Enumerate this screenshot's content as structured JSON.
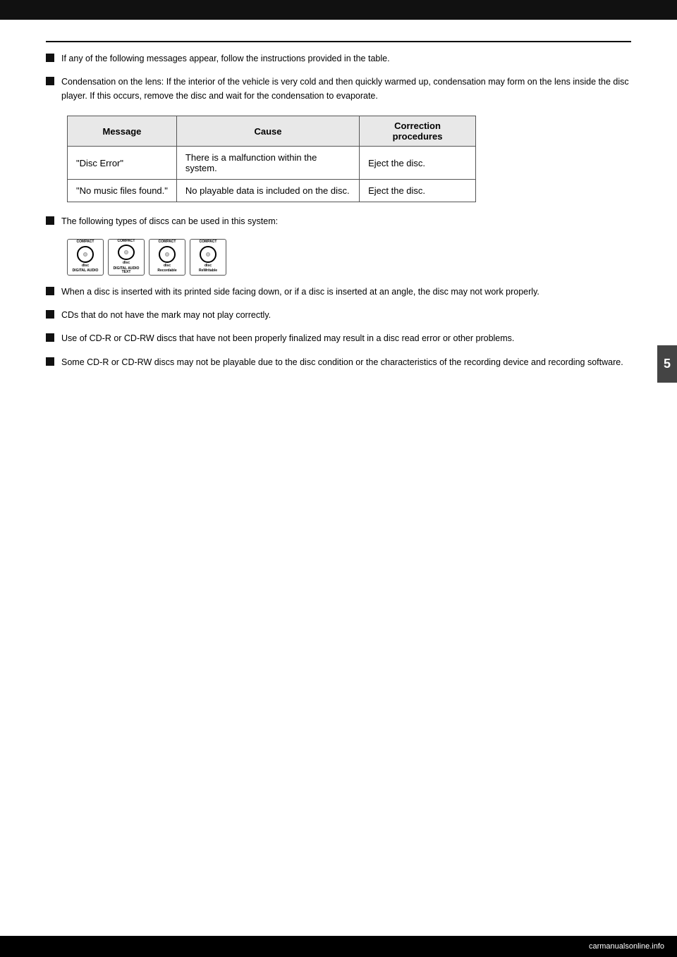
{
  "page": {
    "section_number": "5",
    "top_bar_color": "#111111",
    "header_bar_color": "#555555"
  },
  "table": {
    "headers": [
      "Message",
      "Cause",
      "Correction procedures"
    ],
    "rows": [
      {
        "message": "\"Disc Error\"",
        "cause": "There is a malfunction within the system.",
        "correction": "Eject the disc."
      },
      {
        "message": "\"No music files found.\"",
        "cause": "No playable data is included on the disc.",
        "correction": "Eject the disc."
      }
    ]
  },
  "bullet_sections": [
    {
      "id": "bullet1",
      "text": "If any of the following messages appear, follow the instructions provided in the table."
    },
    {
      "id": "bullet2",
      "text": "Condensation on the lens: If the interior of the vehicle is very cold and then quickly warmed up, condensation may form on the lens inside the disc player. If this occurs, remove the disc and wait for the condensation to evaporate."
    },
    {
      "id": "bullet3",
      "text": "The following types of discs can be used in this system:"
    },
    {
      "id": "bullet4",
      "text": "When a disc is inserted with its printed side facing down, or if a disc is inserted at an angle, the disc may not work properly."
    },
    {
      "id": "bullet5",
      "text": "CDs that do not have the mark may not play correctly."
    },
    {
      "id": "bullet6",
      "text": "Use of CD-R or CD-RW discs that have not been properly finalized may result in a disc read error or other problems."
    },
    {
      "id": "bullet7",
      "text": "Some CD-R or CD-RW discs may not be playable due to the disc condition or the characteristics of the recording device and recording software."
    }
  ],
  "disc_logos": [
    {
      "id": "logo1",
      "top_text": "COMPACT",
      "mid_text": "disc",
      "bot_text": "DIGITAL AUDIO"
    },
    {
      "id": "logo2",
      "top_text": "COMPACT",
      "mid_text": "disc",
      "bot_text": "DIGITAL AUDIO TEXT"
    },
    {
      "id": "logo3",
      "top_text": "COMPACT",
      "mid_text": "disc",
      "bot_text": "Recordable"
    },
    {
      "id": "logo4",
      "top_text": "COMPACT",
      "mid_text": "disc",
      "bot_text": "ReWritable"
    }
  ],
  "watermark": {
    "url_text": "carmanualsonline.info"
  }
}
